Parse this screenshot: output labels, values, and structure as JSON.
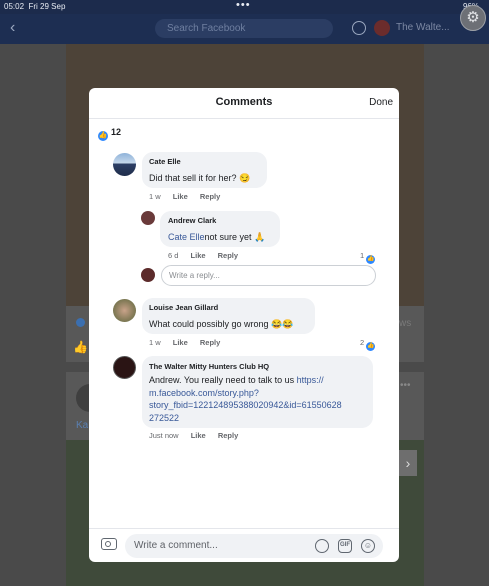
{
  "status_bar": {
    "time": "05:02",
    "date": "Fri 29 Sep",
    "dots": "•••",
    "battery": "96%"
  },
  "facebook_bar": {
    "search_placeholder": "Search Facebook",
    "page_name": "The Walte..."
  },
  "background": {
    "partial_text_left": "Ka",
    "partial_text_right": "ws"
  },
  "modal": {
    "title": "Comments",
    "done_label": "Done",
    "reaction_count": "12",
    "comments": [
      {
        "name": "Cate Elle",
        "text": "Did that sell it for her? 😏",
        "time": "1 w",
        "like": "Like",
        "reply": "Reply"
      },
      {
        "name": "Andrew Clark",
        "mention": "Cate Elle",
        "text": "not sure yet 🙏",
        "time": "6 d",
        "like": "Like",
        "reply": "Reply",
        "likes": "1"
      },
      {
        "reply_placeholder": "Write a reply..."
      },
      {
        "name": "Louise Jean Gillard",
        "text": "What could possibly go wrong 😂😂",
        "time": "1 w",
        "like": "Like",
        "reply": "Reply",
        "likes": "2"
      },
      {
        "name": "The Walter Mitty Hunters Club HQ",
        "text": "Andrew. You really need to talk to us ",
        "link_lines": [
          "https://",
          "m.facebook.com/story.php?",
          "story_fbid=122124895388020942&id=61550628",
          "272522"
        ],
        "time": "Just now",
        "like": "Like",
        "reply": "Reply"
      }
    ],
    "composer_placeholder": "Write a comment...",
    "gif_label": "GIF"
  },
  "colors": {
    "accent": "#2d88ff",
    "link": "#385898",
    "navbar": "#1d2e52"
  }
}
